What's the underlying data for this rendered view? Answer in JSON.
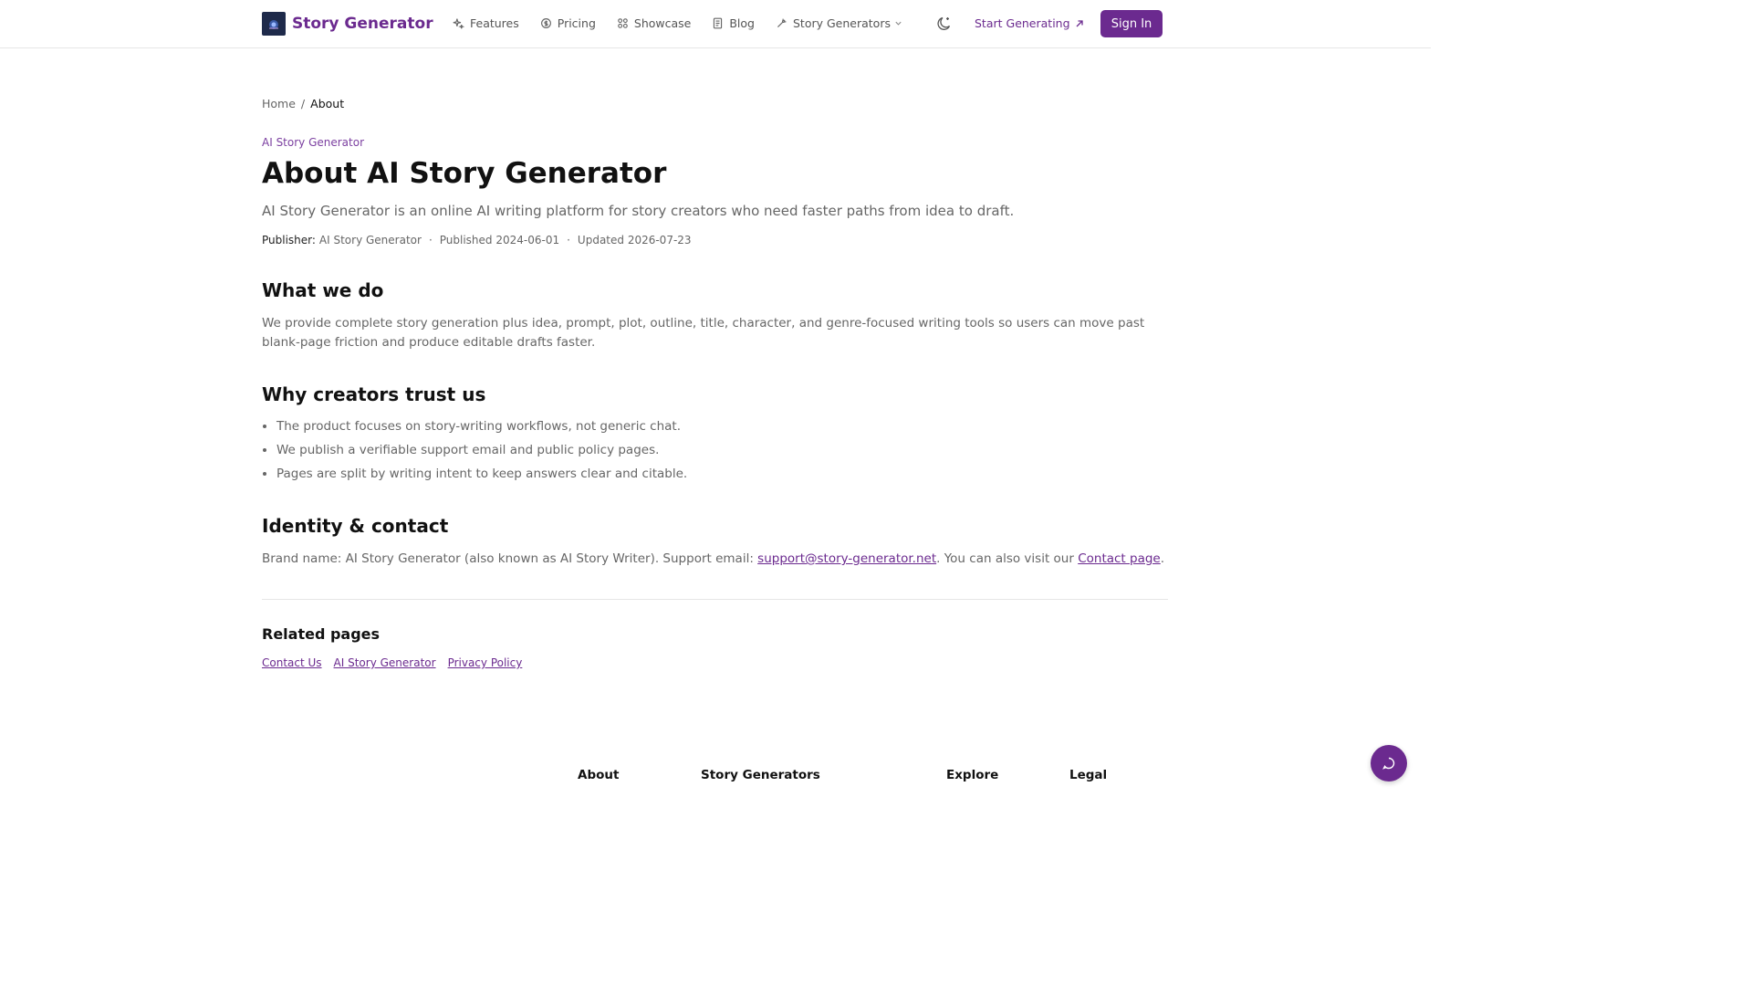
{
  "header": {
    "brand": "Story Generator",
    "nav": [
      {
        "label": "Features",
        "icon": "sparkles-icon"
      },
      {
        "label": "Pricing",
        "icon": "coin-icon"
      },
      {
        "label": "Showcase",
        "icon": "grid-icon"
      },
      {
        "label": "Blog",
        "icon": "document-icon"
      },
      {
        "label": "Story Generators",
        "icon": "wand-icon"
      }
    ],
    "start_label": "Start Generating",
    "signin_label": "Sign In"
  },
  "breadcrumb": {
    "home": "Home",
    "separator": "/",
    "current": "About"
  },
  "eyebrow": "AI Story Generator",
  "title": "About AI Story Generator",
  "lede": "AI Story Generator is an online AI writing platform for story creators who need faster paths from idea to draft.",
  "meta": {
    "publisher_label": "Publisher:",
    "publisher": "AI Story Generator",
    "published": "Published 2024-06-01",
    "updated": "Updated 2026-07-23"
  },
  "sections": {
    "what_we_do": {
      "heading": "What we do",
      "body": "We provide complete story generation plus idea, prompt, plot, outline, title, character, and genre-focused writing tools so users can move past blank-page friction and produce editable drafts faster."
    },
    "trust": {
      "heading": "Why creators trust us",
      "items": [
        "The product focuses on story-writing workflows, not generic chat.",
        "We publish a verifiable support email and public policy pages.",
        "Pages are split by writing intent to keep answers clear and citable."
      ]
    },
    "identity": {
      "heading": "Identity & contact",
      "text_before": "Brand name: AI Story Generator (also known as AI Story Writer). Support email: ",
      "email": "support@story-generator.net",
      "text_middle": ". You can also visit our ",
      "contact_link": "Contact page",
      "text_after": "."
    }
  },
  "related": {
    "heading": "Related pages",
    "links": [
      "Contact Us",
      "AI Story Generator",
      "Privacy Policy"
    ]
  },
  "footer": {
    "columns": [
      "About",
      "Story Generators",
      "Explore",
      "Legal"
    ]
  },
  "colors": {
    "accent": "#6b2a8f",
    "text": "#111111",
    "muted": "#666666"
  }
}
